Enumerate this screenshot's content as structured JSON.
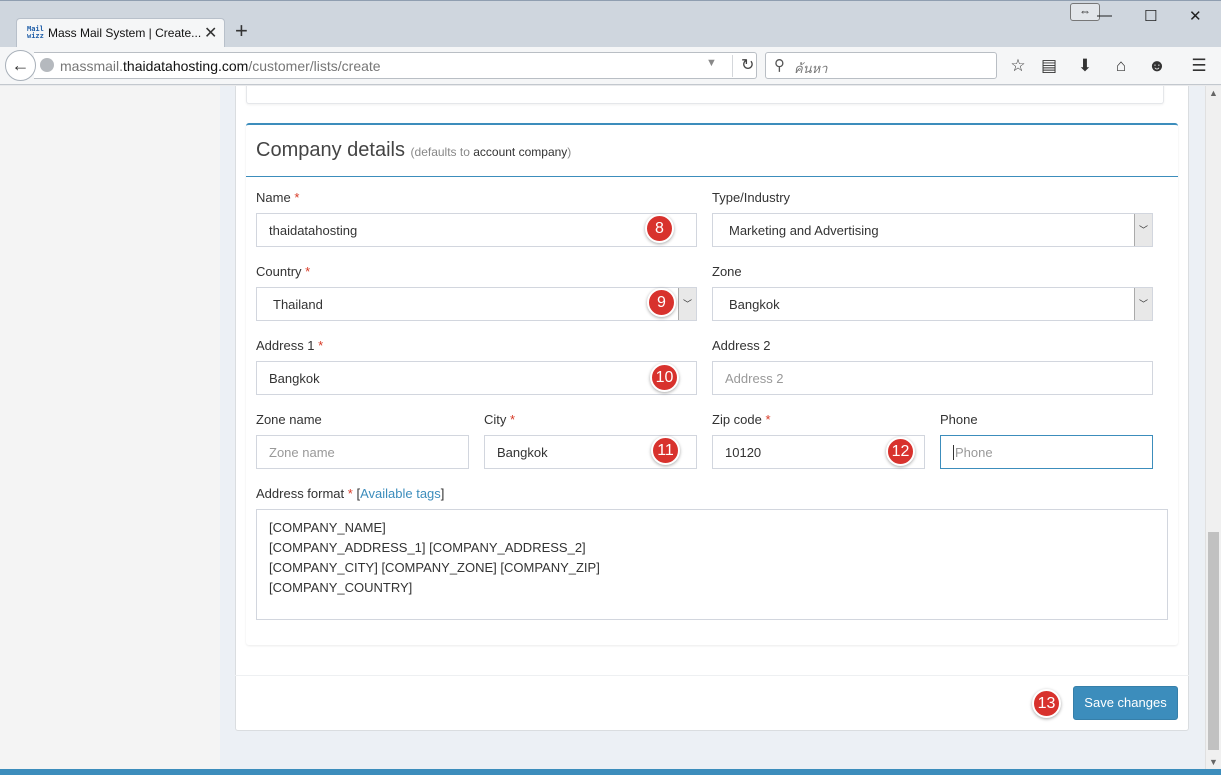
{
  "browser": {
    "tab_title": "Mass Mail System | Create...",
    "favicon_text": "Mail wizz",
    "url_prefix": "massmail.",
    "url_host": "thaidatahosting.com",
    "url_path": "/customer/lists/create",
    "search_placeholder": "ค้นหา",
    "new_tab": "+",
    "close_tab": "✕"
  },
  "company": {
    "title": "Company details",
    "subtitle_prefix": "(defaults to ",
    "subtitle_link": "account company",
    "subtitle_suffix": ")",
    "name_label": "Name",
    "name_value": "thaidatahosting",
    "industry_label": "Type/Industry",
    "industry_value": "Marketing and Advertising",
    "country_label": "Country",
    "country_value": "Thailand",
    "zone_label": "Zone",
    "zone_value": "Bangkok",
    "address1_label": "Address 1",
    "address1_value": "Bangkok",
    "address2_label": "Address 2",
    "address2_placeholder": "Address 2",
    "zone_name_label": "Zone name",
    "zone_name_placeholder": "Zone name",
    "city_label": "City",
    "city_value": "Bangkok",
    "zip_label": "Zip code",
    "zip_value": "10120",
    "phone_label": "Phone",
    "phone_placeholder": "Phone",
    "address_format_label": "Address format",
    "available_tags_link": "Available tags",
    "address_format_lines": [
      "[COMPANY_NAME]",
      "[COMPANY_ADDRESS_1] [COMPANY_ADDRESS_2]",
      "[COMPANY_CITY] [COMPANY_ZONE] [COMPANY_ZIP]",
      "[COMPANY_COUNTRY]"
    ],
    "required_mark": "*"
  },
  "markers": [
    "8",
    "9",
    "10",
    "11",
    "12",
    "13"
  ],
  "actions": {
    "save_label": "Save changes"
  },
  "colors": {
    "primary": "#3c8dbc",
    "marker": "#d8322d",
    "required": "#d73925"
  }
}
